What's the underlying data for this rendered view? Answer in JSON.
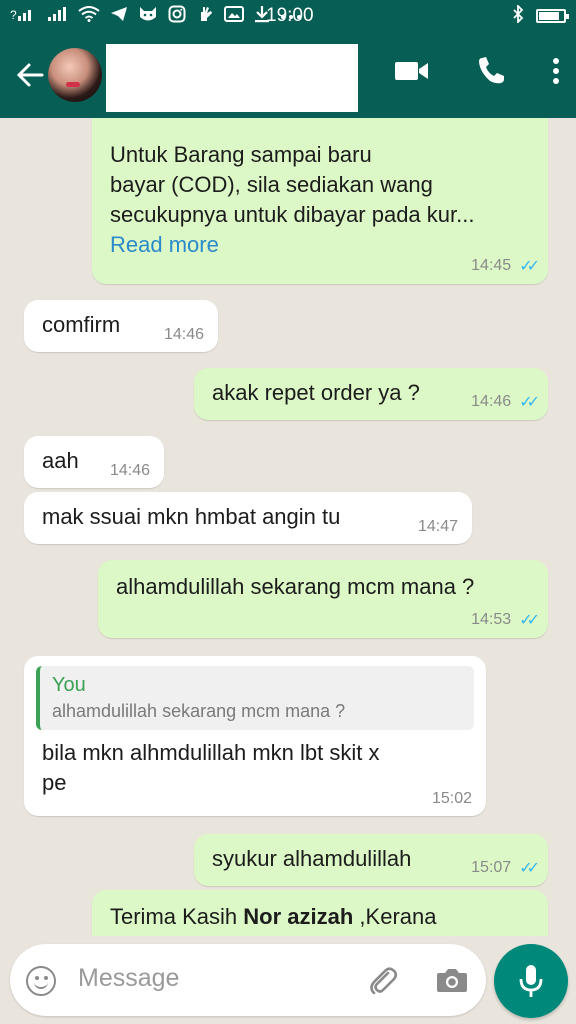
{
  "status_bar": {
    "time": "19:00",
    "icons": [
      "sim-signal-icon",
      "signal-icon",
      "wifi-icon",
      "telegram-icon",
      "cat-icon",
      "instagram-icon",
      "hand-icon",
      "gallery-icon",
      "download-icon",
      "more-icon",
      "bluetooth-icon",
      "battery-icon"
    ]
  },
  "header": {
    "contact_name": "",
    "icons": [
      "back-arrow-icon",
      "video-call-icon",
      "phone-icon",
      "more-vert-icon"
    ]
  },
  "messages": [
    {
      "direction": "out",
      "lines": [
        "Untuk Barang sampai baru",
        "bayar (COD), sila sediakan wang",
        "secukupnya untuk dibayar pada kur..."
      ],
      "read_more": "Read more",
      "time": "14:45",
      "ticks": "read"
    },
    {
      "direction": "in",
      "text": "comfirm",
      "time": "14:46"
    },
    {
      "direction": "out",
      "text": "akak repet order ya ?",
      "time": "14:46",
      "ticks": "read"
    },
    {
      "direction": "in",
      "text": "aah",
      "time": "14:46"
    },
    {
      "direction": "in",
      "text": "mak ssuai mkn hmbat angin tu",
      "time": "14:47"
    },
    {
      "direction": "out",
      "text": "alhamdulillah sekarang mcm mana ?",
      "time": "14:53",
      "ticks": "read"
    },
    {
      "direction": "in",
      "quote_author": "You",
      "quote_text": "alhamdulillah sekarang mcm mana ?",
      "lines": [
        "bila mkn alhmdulillah mkn lbt skit x",
        "pe"
      ],
      "time": "15:02"
    },
    {
      "direction": "out",
      "text": "syukur alhamdulillah",
      "time": "15:07",
      "ticks": "read"
    },
    {
      "direction": "out",
      "part1": "Terima Kasih ",
      "part_bold": "Nor azizah",
      "part2": " ,Kerana"
    }
  ],
  "input_bar": {
    "placeholder": "Message",
    "icons": [
      "emoji-icon",
      "attach-icon",
      "camera-icon",
      "mic-icon"
    ]
  },
  "colors": {
    "header": "#075e54",
    "outgoing_bubble": "#dcf8c6",
    "incoming_bubble": "#ffffff",
    "background": "#e9e4dc",
    "read_ticks": "#34b7f1",
    "link": "#2b8ac9",
    "mic_button": "#00897b"
  }
}
